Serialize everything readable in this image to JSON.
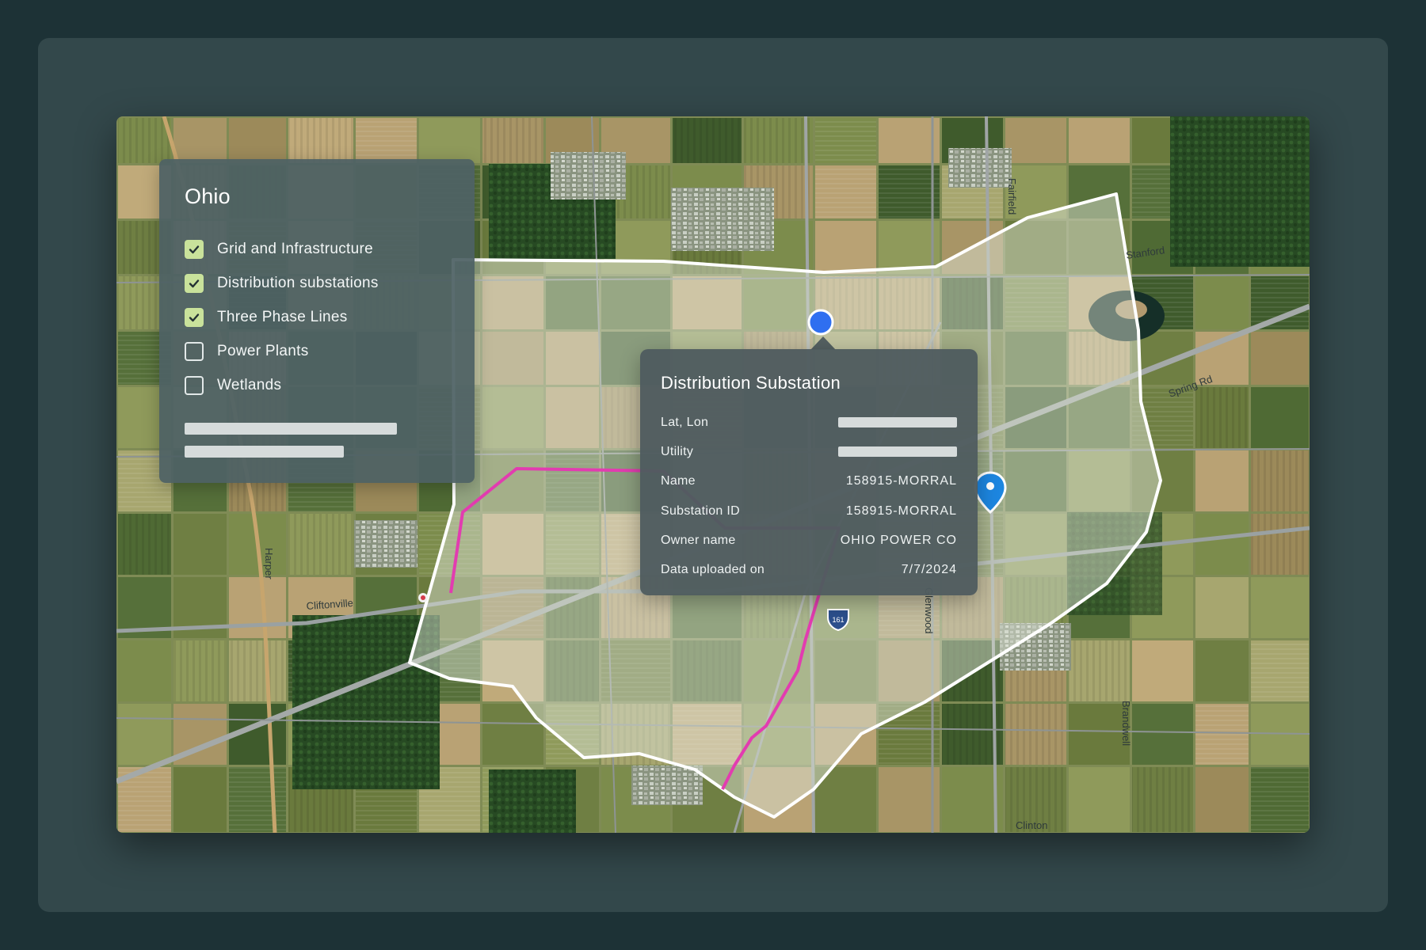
{
  "layer_panel": {
    "title": "Ohio",
    "layers": [
      {
        "label": "Grid and Infrastructure",
        "checked": true
      },
      {
        "label": "Distribution substations",
        "checked": true
      },
      {
        "label": "Three Phase Lines",
        "checked": true
      },
      {
        "label": "Power Plants",
        "checked": false
      },
      {
        "label": "Wetlands",
        "checked": false
      }
    ]
  },
  "popup": {
    "title": "Distribution Substation",
    "rows": [
      {
        "label": "Lat, Lon",
        "value": null
      },
      {
        "label": "Utility",
        "value": null
      },
      {
        "label": "Name",
        "value": "158915-MORRAL"
      },
      {
        "label": "Substation ID",
        "value": "158915-MORRAL"
      },
      {
        "label": "Owner name",
        "value": "OHIO POWER CO"
      },
      {
        "label": "Data uploaded on",
        "value": "7/7/2024"
      }
    ]
  },
  "map": {
    "road_labels": [
      "Cliftonville",
      "Spring Rd",
      "Stanford",
      "Fairfield",
      "Glenwood",
      "Brandwell",
      "Clinton",
      "Harper"
    ],
    "highway_shield": "161",
    "colors": {
      "boundary": "#ffffff",
      "power_line": "#e23cb0",
      "substation_marker": "#2f6ff0",
      "location_pin": "#1d86e0",
      "checkbox_checked": "#c9e29b"
    },
    "icons": [
      "substation-marker-icon",
      "location-pin-icon",
      "check-icon"
    ]
  }
}
